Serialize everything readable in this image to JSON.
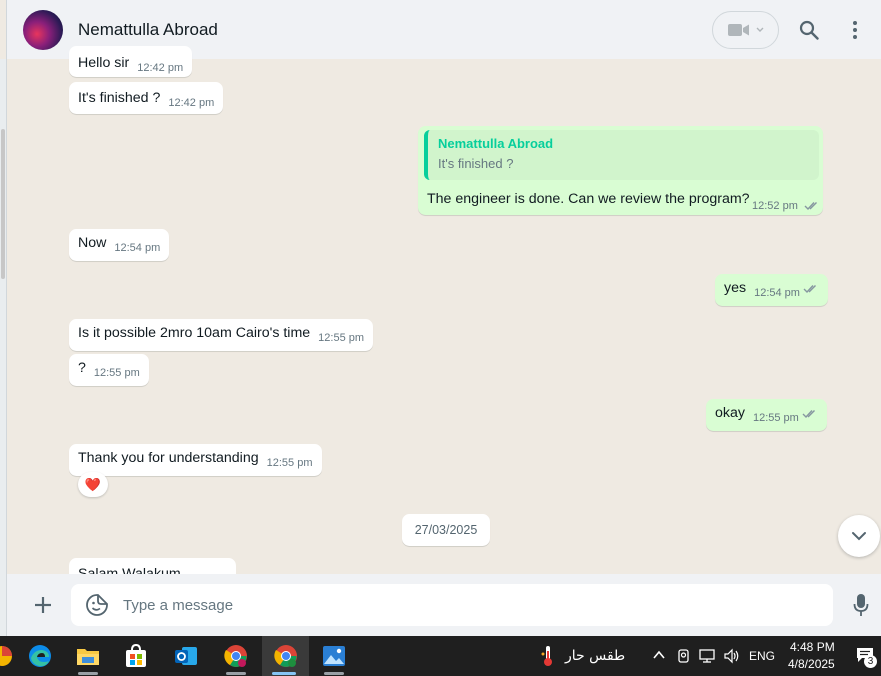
{
  "header": {
    "contact_name": "Nemattulla Abroad"
  },
  "messages": [
    {
      "id": "m1",
      "direction": "in",
      "text": "Hello sir",
      "time": "12:42 pm"
    },
    {
      "id": "m2",
      "direction": "in",
      "text": "It's finished ?",
      "time": "12:42 pm"
    },
    {
      "id": "m3",
      "direction": "out",
      "quote_name": "Nemattulla Abroad",
      "quote_text": "It's finished ?",
      "text": "The engineer is done. Can we review the program?",
      "time": "12:52 pm"
    },
    {
      "id": "m4",
      "direction": "in",
      "text": "Now",
      "time": "12:54 pm"
    },
    {
      "id": "m5",
      "direction": "out",
      "text": "yes",
      "time": "12:54 pm"
    },
    {
      "id": "m6",
      "direction": "in",
      "text": "Is it possible 2mro 10am Cairo's time",
      "time": "12:55 pm"
    },
    {
      "id": "m7",
      "direction": "in",
      "text": "?",
      "time": "12:55 pm"
    },
    {
      "id": "m8",
      "direction": "out",
      "text": "okay",
      "time": "12:55 pm"
    },
    {
      "id": "m9",
      "direction": "in",
      "text": "Thank you for understanding",
      "time": "12:55 pm",
      "reaction": "❤️"
    },
    {
      "id": "m10",
      "direction": "in",
      "text": "Salam Walakum"
    }
  ],
  "date_separator": "27/03/2025",
  "composer": {
    "placeholder": "Type a message"
  },
  "taskbar": {
    "weather_text": "طقس حار",
    "language": "ENG",
    "time": "4:48 PM",
    "date": "4/8/2025",
    "notification_count": "3"
  },
  "colors": {
    "outgoing_bubble": "#d9fdd3",
    "incoming_bubble": "#ffffff",
    "accent": "#06cf9c",
    "chat_background": "#efeae2",
    "read_check": "#53bdeb"
  }
}
